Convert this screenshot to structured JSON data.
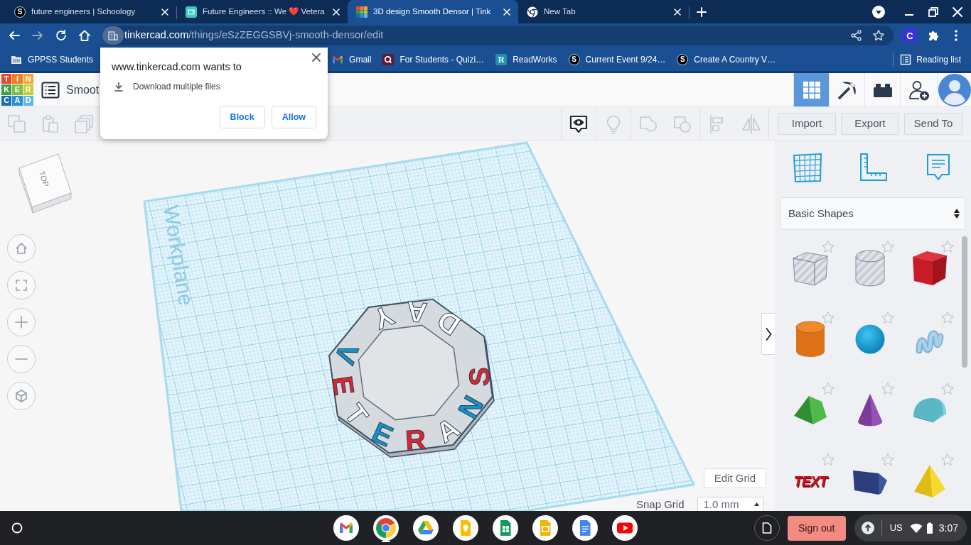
{
  "tabs": [
    {
      "kind": "schoology",
      "badge": "S",
      "title": "future engineers | Schoology",
      "selected": false
    },
    {
      "kind": "futureengineers",
      "title": "Future Engineers :: We ❤️ Vetera",
      "selected": false
    },
    {
      "kind": "tinkercad",
      "title": "3D design Smooth Densor | Tink",
      "selected": true
    },
    {
      "kind": "chrome",
      "title": "New Tab",
      "selected": false
    }
  ],
  "address_bar": {
    "url": "tinkercad.com/things/eSzZEGGSBVj-smooth-densor/edit",
    "extension_badge": "C"
  },
  "bookmarks": [
    {
      "kind": "folder",
      "label": "GPPSS Students"
    },
    {
      "kind": "gmail",
      "label": "Gmail"
    },
    {
      "kind": "quizizz",
      "label": "For Students - Quizi…"
    },
    {
      "kind": "readworks",
      "badge": "R",
      "label": "ReadWorks"
    },
    {
      "kind": "schoology",
      "badge": "S",
      "label": "Current Event 9/24…"
    },
    {
      "kind": "schoology",
      "badge": "S",
      "label": "Create A Country V…"
    }
  ],
  "reading_list": "Reading list",
  "permission_popup": {
    "title": "www.tinkercad.com wants to",
    "request": "Download multiple files",
    "buttons": [
      "Block",
      "Allow"
    ]
  },
  "app_header": {
    "logo": [
      {
        "char": "T",
        "color": "#e8472d"
      },
      {
        "char": "I",
        "color": "#f47c22"
      },
      {
        "char": "N",
        "color": "#f7a233"
      },
      {
        "char": "K",
        "color": "#3d9e47"
      },
      {
        "char": "E",
        "color": "#78bf43"
      },
      {
        "char": "R",
        "color": "#c5cf2e"
      },
      {
        "char": "C",
        "color": "#1a6db3"
      },
      {
        "char": "A",
        "color": "#2c8fd6"
      },
      {
        "char": "D",
        "color": "#60b6ea"
      }
    ],
    "title": "Smoot",
    "views": [
      {
        "kind": "grid",
        "selected": true
      },
      {
        "kind": "pickaxe",
        "selected": false
      },
      {
        "kind": "bricks",
        "selected": false
      }
    ]
  },
  "toolbar": {
    "edit_tools": [
      {
        "kind": "copy",
        "disabled": true
      },
      {
        "kind": "paste",
        "disabled": true
      },
      {
        "kind": "duplicate",
        "disabled": true
      }
    ],
    "tool_groups": [
      {
        "tools": [
          {
            "kind": "notes",
            "disabled": false
          }
        ]
      },
      {
        "tools": [
          {
            "kind": "bulb",
            "disabled": true
          }
        ]
      },
      {
        "tools": [
          {
            "kind": "group",
            "disabled": true
          },
          {
            "kind": "ungroup",
            "disabled": true
          }
        ]
      },
      {
        "tools": [
          {
            "kind": "align",
            "disabled": true
          },
          {
            "kind": "mirror",
            "disabled": true
          }
        ]
      }
    ],
    "buttons": [
      "Import",
      "Export",
      "Send To"
    ]
  },
  "viewport": {
    "view_cube_label": "TOP",
    "workplane_label": "Workplane",
    "nav_buttons": [
      {
        "kind": "home"
      },
      {
        "kind": "fit"
      },
      {
        "kind": "zoomin"
      },
      {
        "kind": "zoomout"
      },
      {
        "kind": "ortho"
      }
    ],
    "model_letters": [
      {
        "char": "V",
        "color": "#1592c9"
      },
      {
        "char": "E",
        "color": "#e0242f"
      },
      {
        "char": "T",
        "color": "#ffffff"
      },
      {
        "char": "E",
        "color": "#1592c9"
      },
      {
        "char": "R",
        "color": "#e0242f"
      },
      {
        "char": "A",
        "color": "#ffffff"
      },
      {
        "char": "N",
        "color": "#1592c9"
      },
      {
        "char": "S",
        "color": "#e0242f"
      },
      {
        "char": "D",
        "color": "#ffffff"
      },
      {
        "char": "A",
        "color": "#ffffff"
      },
      {
        "char": "Y",
        "color": "#ffffff"
      }
    ],
    "edit_grid": "Edit Grid",
    "snap_grid": {
      "label": "Snap Grid",
      "value": "1.0 mm"
    }
  },
  "shapes_panel": {
    "tools": [
      {
        "kind": "workplane"
      },
      {
        "kind": "ruler"
      },
      {
        "kind": "notes"
      }
    ],
    "category": "Basic Shapes",
    "shapes": [
      {
        "kind": "boxhole",
        "starred": false
      },
      {
        "kind": "cylinderhole",
        "starred": false
      },
      {
        "kind": "box",
        "starred": false
      },
      {
        "kind": "cylinder",
        "starred": false
      },
      {
        "kind": "sphere",
        "starred": false
      },
      {
        "kind": "scribble",
        "starred": false
      },
      {
        "kind": "roof",
        "starred": false
      },
      {
        "kind": "cone",
        "starred": false
      },
      {
        "kind": "roundroof",
        "starred": false
      },
      {
        "kind": "text",
        "label": "TEXT",
        "starred": false
      },
      {
        "kind": "polygon",
        "starred": false
      },
      {
        "kind": "pyramid",
        "starred": false
      }
    ]
  },
  "taskbar": {
    "apps": [
      {
        "kind": "gmail",
        "running": false
      },
      {
        "kind": "chrome",
        "running": true
      },
      {
        "kind": "drive",
        "running": false
      },
      {
        "kind": "keep",
        "running": false
      },
      {
        "kind": "sheets",
        "running": false
      },
      {
        "kind": "slides",
        "running": false
      },
      {
        "kind": "docs",
        "running": false
      },
      {
        "kind": "youtube",
        "running": false
      }
    ],
    "sign_out": "Sign out",
    "keyboard": "US",
    "time": "3:07"
  }
}
